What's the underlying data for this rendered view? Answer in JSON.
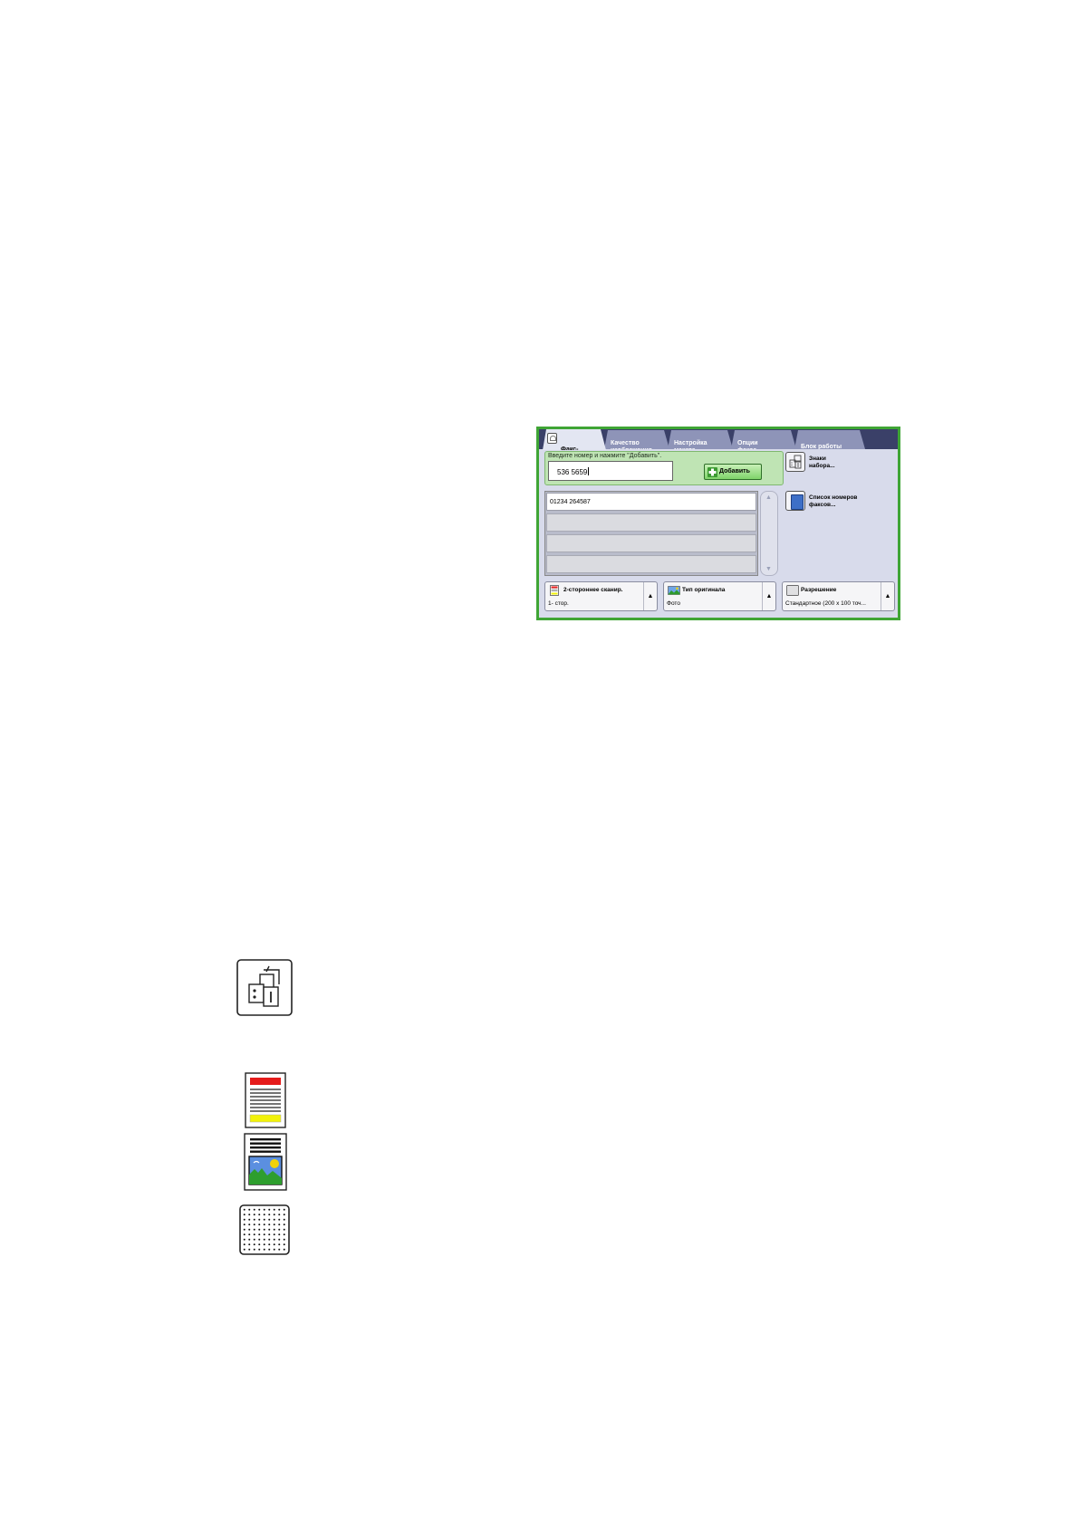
{
  "tabs": [
    {
      "label": "Факс-\nсервер",
      "active": true
    },
    {
      "label": "Качество\nизображения"
    },
    {
      "label": "Настройка\nмакета"
    },
    {
      "label": "Опции\nфакса"
    },
    {
      "label": "Блок работы"
    }
  ],
  "entry": {
    "label": "Введите номер и нажмите \"Добавить\".",
    "value": "536 5659",
    "add_label": "Добавить"
  },
  "recipients": [
    "01234 264587",
    "",
    "",
    ""
  ],
  "side_buttons": {
    "dial_chars": "Знаки\nнабора...",
    "fax_list": "Список номеров\nфаксов..."
  },
  "bottom_buttons": [
    {
      "title": "2-стороннее сканир.",
      "value": "1- стор."
    },
    {
      "title": "Тип оригинала",
      "value": "Фото"
    },
    {
      "title": "Разрешение",
      "value": "Стандартное (200 x 100 точ..."
    }
  ],
  "colors": {
    "frame_green": "#3fa535",
    "tabbar_navy": "#3a4068",
    "entry_green": "#bfe4b4",
    "add_button_green": "#7fd46a",
    "icon_red": "#e51b1b",
    "icon_yellow": "#f2f20a",
    "icon_blue": "#3d6fc7"
  },
  "icons": [
    "dial-characters-icon",
    "two-sided-scan-icon",
    "original-type-photo-icon",
    "resolution-icon"
  ]
}
